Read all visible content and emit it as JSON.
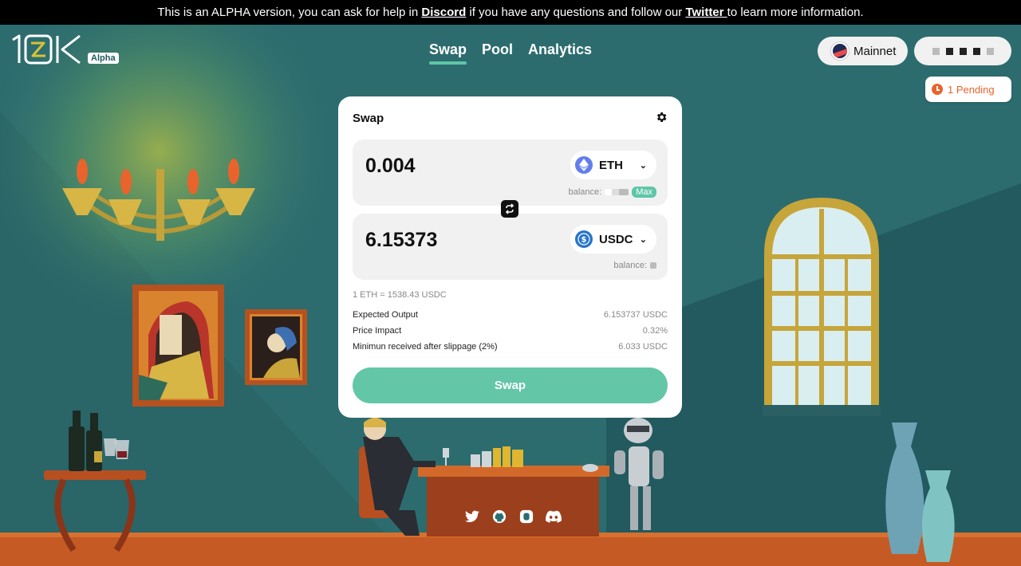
{
  "banner": {
    "text_before": "This is an ALPHA version, you can ask for help in ",
    "discord_link": "Discord",
    "text_middle": " if you have any questions and follow our ",
    "twitter_link": "Twitter ",
    "text_after": "to learn more information."
  },
  "logo": {
    "alpha_badge": "Alpha"
  },
  "nav": {
    "tabs": [
      {
        "label": "Swap",
        "active": true
      },
      {
        "label": "Pool",
        "active": false
      },
      {
        "label": "Analytics",
        "active": false
      }
    ]
  },
  "network": {
    "label": "Mainnet"
  },
  "pending": {
    "label": "1 Pending"
  },
  "swap": {
    "title": "Swap",
    "from": {
      "amount": "0.004",
      "token": "ETH",
      "balance_label": "balance:",
      "max_label": "Max"
    },
    "to": {
      "amount": "6.15373",
      "token": "USDC",
      "balance_label": "balance:"
    },
    "rate": "1 ETH = 1538.43 USDC",
    "details": [
      {
        "label": "Expected Output",
        "value": "6.153737 USDC"
      },
      {
        "label": "Price Impact",
        "value": "0.32%"
      },
      {
        "label": "Minimun received after slippage (2%)",
        "value": "6.033 USDC"
      }
    ],
    "button_label": "Swap"
  },
  "socials": [
    "twitter-icon",
    "github-icon",
    "medium-icon",
    "discord-icon"
  ],
  "colors": {
    "accent": "#5fc6a8",
    "pending": "#e8642c",
    "background": "#2b6b6e"
  }
}
